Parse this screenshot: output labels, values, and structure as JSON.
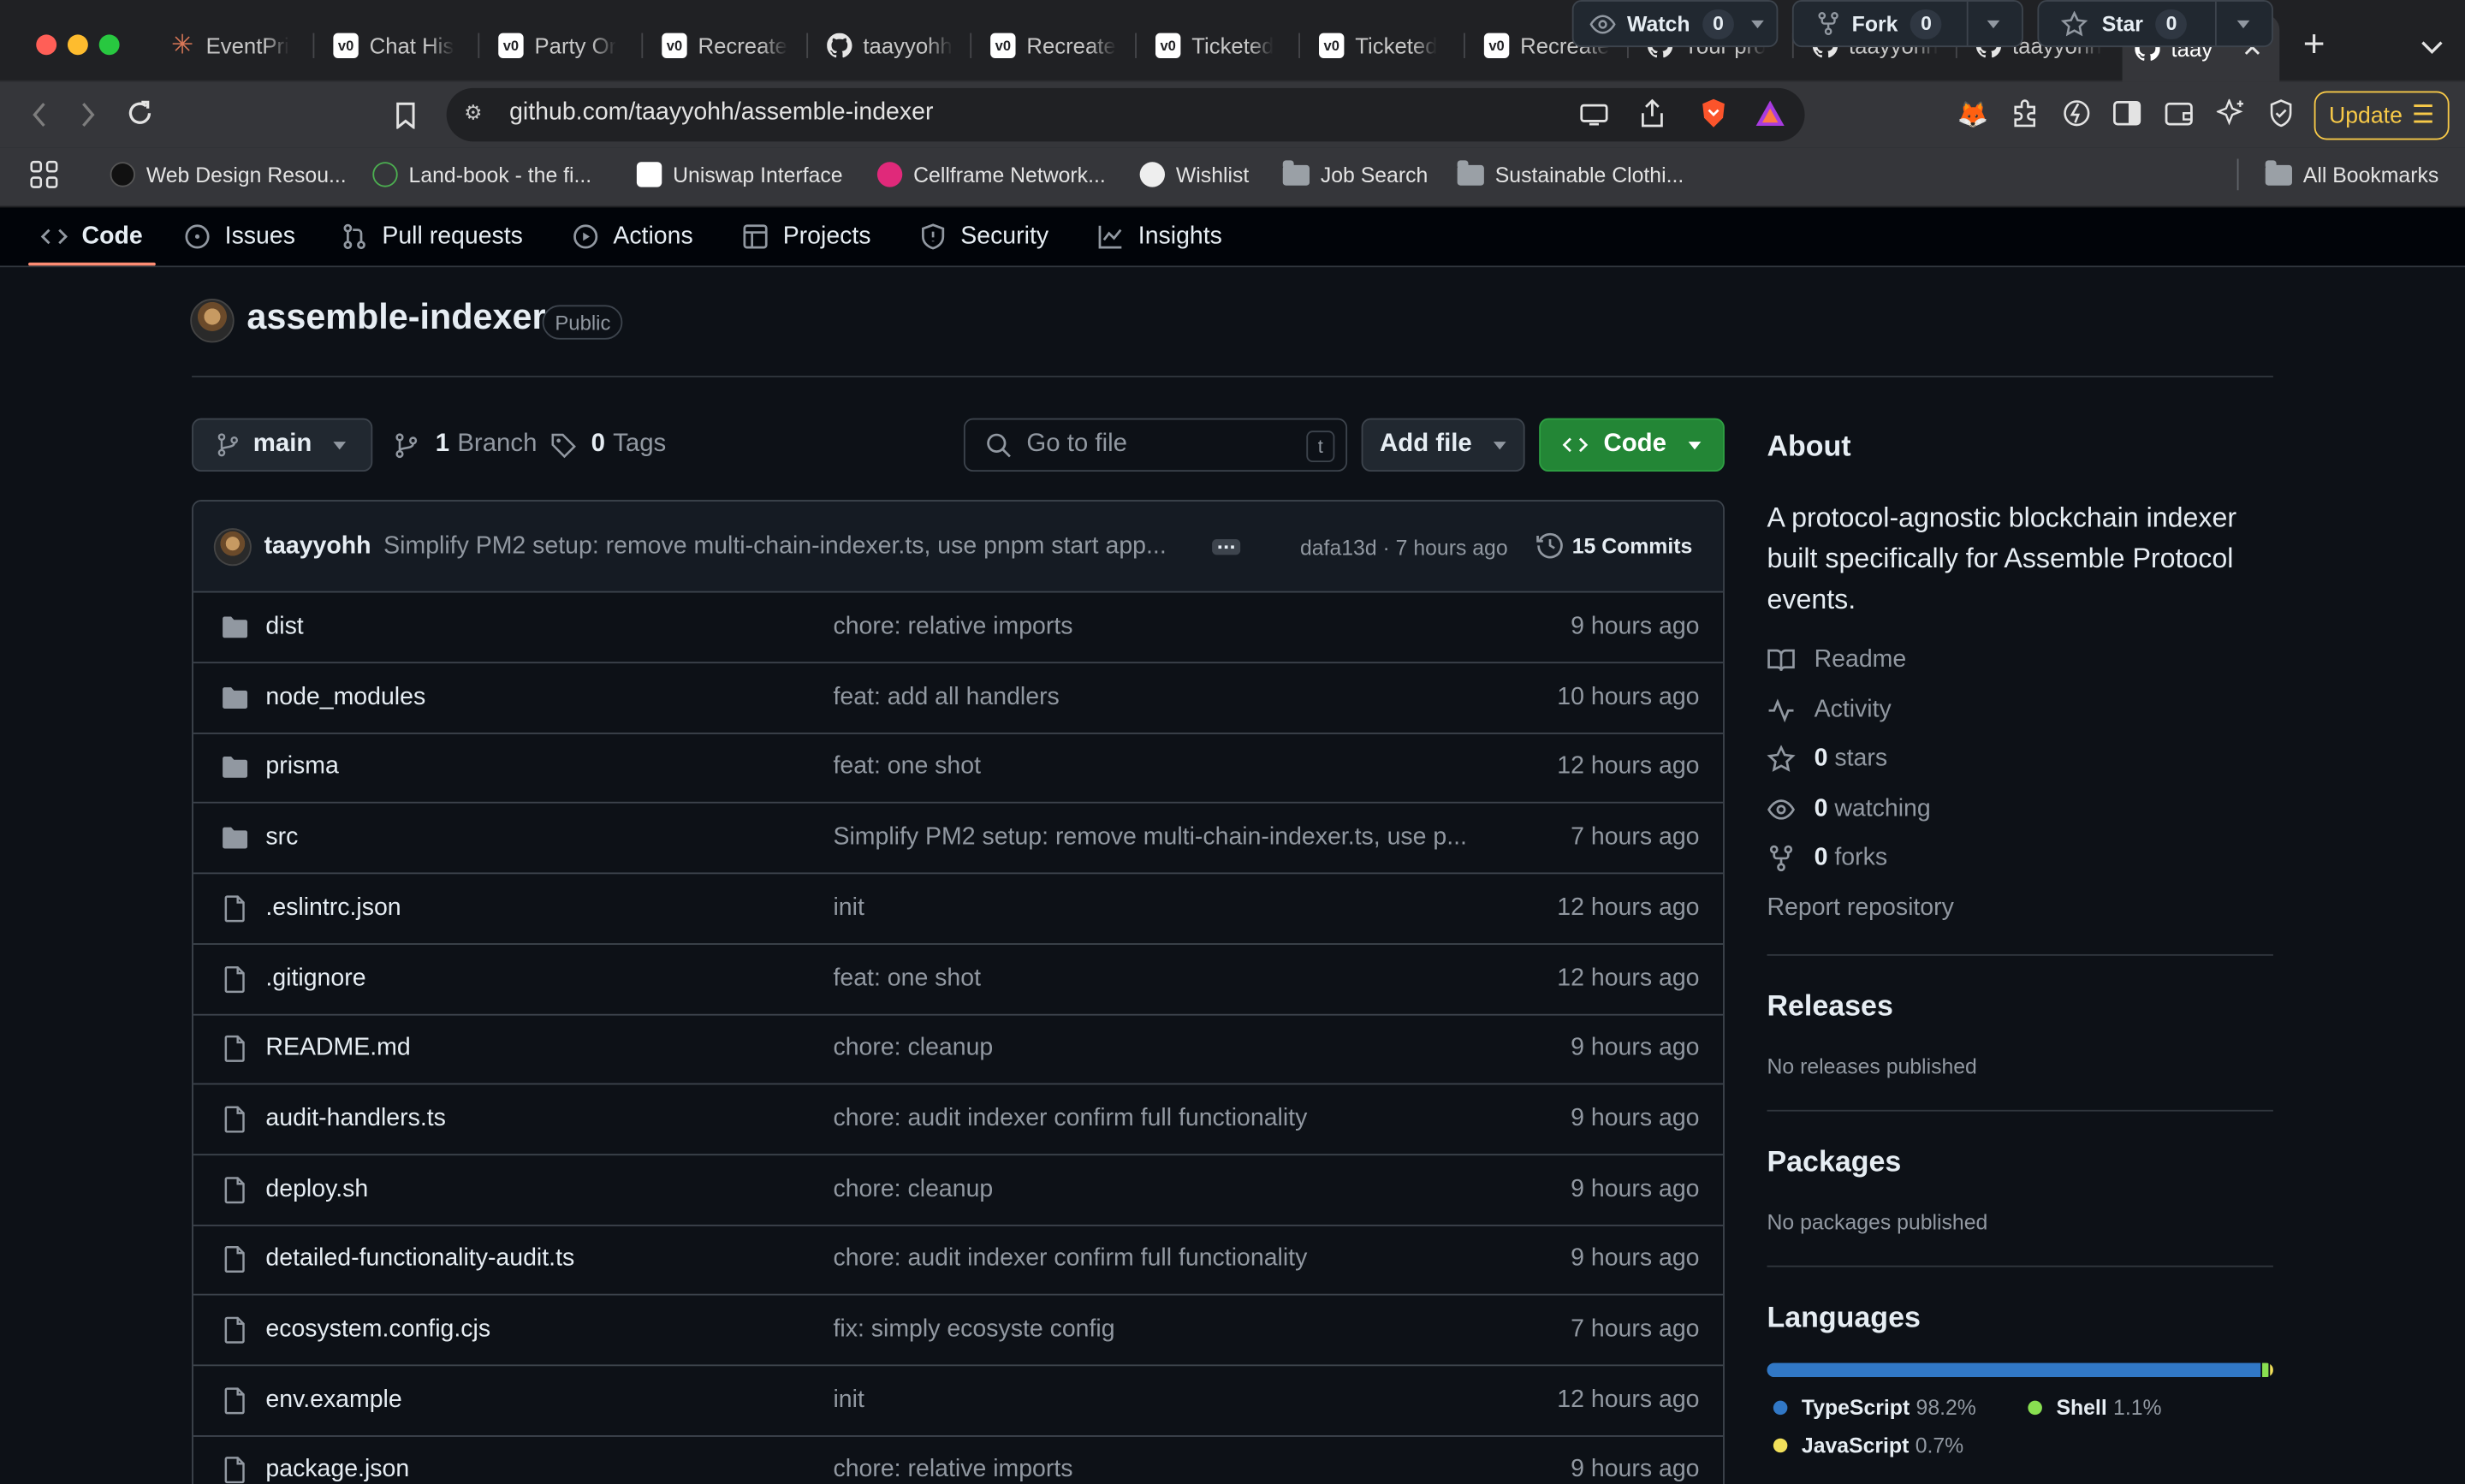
{
  "browser": {
    "tabs": [
      {
        "label": "EventPri",
        "icon": "asterisk-icon"
      },
      {
        "label": "Chat His",
        "icon": "vc-icon"
      },
      {
        "label": "Party Or",
        "icon": "vc-icon"
      },
      {
        "label": "Recreate",
        "icon": "vc-icon"
      },
      {
        "label": "taayyohh",
        "icon": "github-icon"
      },
      {
        "label": "Recreate",
        "icon": "vc-icon"
      },
      {
        "label": "Ticketed",
        "icon": "vc-icon"
      },
      {
        "label": "Ticketed",
        "icon": "vc-icon"
      },
      {
        "label": "Recreate",
        "icon": "vc-icon"
      },
      {
        "label": "Your pro",
        "icon": "github-icon"
      },
      {
        "label": "taayyohh",
        "icon": "github-icon"
      },
      {
        "label": "taayyohh",
        "icon": "github-icon"
      },
      {
        "label": "taay",
        "icon": "github-icon"
      }
    ],
    "url": "github.com/taayyohh/assemble-indexer",
    "update_label": "Update",
    "bookmarks": [
      {
        "label": "Web Design Resou..."
      },
      {
        "label": "Land-book - the fi..."
      },
      {
        "label": "Uniswap Interface"
      },
      {
        "label": "Cellframe Network..."
      },
      {
        "label": "Wishlist"
      },
      {
        "label": "Job Search"
      },
      {
        "label": "Sustainable Clothi..."
      },
      {
        "label": "All Bookmarks"
      }
    ]
  },
  "repo_nav": [
    {
      "label": "Code"
    },
    {
      "label": "Issues"
    },
    {
      "label": "Pull requests"
    },
    {
      "label": "Actions"
    },
    {
      "label": "Projects"
    },
    {
      "label": "Security"
    },
    {
      "label": "Insights"
    }
  ],
  "repo": {
    "name": "assemble-indexer",
    "visibility": "Public",
    "watch_label": "Watch",
    "watch_count": "0",
    "fork_label": "Fork",
    "fork_count": "0",
    "star_label": "Star",
    "star_count": "0"
  },
  "controls": {
    "branch": "main",
    "branch_count": "1",
    "branch_label": "Branch",
    "tag_count": "0",
    "tag_label": "Tags",
    "goto_placeholder": "Go to file",
    "goto_shortcut": "t",
    "add_file_label": "Add file",
    "code_label": "Code"
  },
  "latest_commit": {
    "author": "taayyohh",
    "message": "Simplify PM2 setup: remove multi-chain-indexer.ts, use pnpm start app...",
    "meta": "dafa13d · 7 hours ago",
    "commits_label": "15 Commits"
  },
  "files": [
    {
      "name": "dist",
      "type": "folder",
      "message": "chore: relative imports",
      "time": "9 hours ago"
    },
    {
      "name": "node_modules",
      "type": "folder",
      "message": "feat: add all handlers",
      "time": "10 hours ago"
    },
    {
      "name": "prisma",
      "type": "folder",
      "message": "feat: one shot",
      "time": "12 hours ago"
    },
    {
      "name": "src",
      "type": "folder",
      "message": "Simplify PM2 setup: remove multi-chain-indexer.ts, use p...",
      "time": "7 hours ago"
    },
    {
      "name": ".eslintrc.json",
      "type": "file",
      "message": "init",
      "time": "12 hours ago"
    },
    {
      "name": ".gitignore",
      "type": "file",
      "message": "feat: one shot",
      "time": "12 hours ago"
    },
    {
      "name": "README.md",
      "type": "file",
      "message": "chore: cleanup",
      "time": "9 hours ago"
    },
    {
      "name": "audit-handlers.ts",
      "type": "file",
      "message": "chore: audit indexer confirm full functionality",
      "time": "9 hours ago"
    },
    {
      "name": "deploy.sh",
      "type": "file",
      "message": "chore: cleanup",
      "time": "9 hours ago"
    },
    {
      "name": "detailed-functionality-audit.ts",
      "type": "file",
      "message": "chore: audit indexer confirm full functionality",
      "time": "9 hours ago"
    },
    {
      "name": "ecosystem.config.cjs",
      "type": "file",
      "message": "fix: simply ecosyste config",
      "time": "7 hours ago"
    },
    {
      "name": "env.example",
      "type": "file",
      "message": "init",
      "time": "12 hours ago"
    },
    {
      "name": "package.json",
      "type": "file",
      "message": "chore: relative imports",
      "time": "9 hours ago"
    }
  ],
  "about": {
    "heading": "About",
    "description_lines": [
      "A protocol-agnostic blockchain indexer",
      "built specifically for Assemble Protocol",
      "events."
    ],
    "readme": "Readme",
    "activity": "Activity",
    "stars_count": "0",
    "stars_label": "stars",
    "watching_count": "0",
    "watching_label": "watching",
    "forks_count": "0",
    "forks_label": "forks",
    "report": "Report repository"
  },
  "releases": {
    "heading": "Releases",
    "text": "No releases published"
  },
  "packages": {
    "heading": "Packages",
    "text": "No packages published"
  },
  "languages": {
    "heading": "Languages",
    "items": [
      {
        "name": "TypeScript",
        "percent": "98.2%",
        "share": 98.2,
        "color": "#3178c6"
      },
      {
        "name": "Shell",
        "percent": "1.1%",
        "share": 1.1,
        "color": "#89e051"
      },
      {
        "name": "JavaScript",
        "percent": "0.7%",
        "share": 0.7,
        "color": "#f1e05a"
      }
    ]
  },
  "colors": {
    "accent_green": "#238636",
    "nav_underline": "#fd8c73",
    "update_button": "#f7c948"
  }
}
